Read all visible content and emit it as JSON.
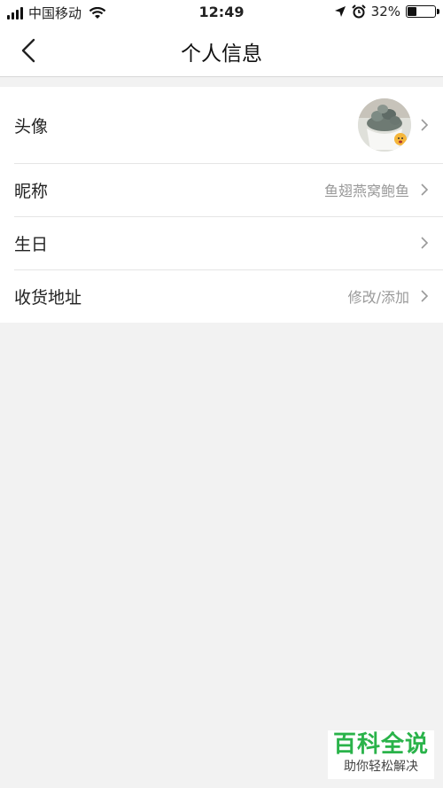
{
  "status_bar": {
    "carrier": "中国移动",
    "time": "12:49",
    "battery": "32%",
    "battery_level": 0.32
  },
  "nav": {
    "title": "个人信息",
    "back_icon": "chevron-left-icon"
  },
  "rows": [
    {
      "label": "头像",
      "value": ""
    },
    {
      "label": "昵称",
      "value": "鱼翅燕窝鲍鱼"
    },
    {
      "label": "生日",
      "value": ""
    },
    {
      "label": "收货地址",
      "value": "修改/添加"
    }
  ],
  "watermark": {
    "title": "百科全说",
    "subtitle": "助你轻松解决"
  },
  "colors": {
    "background": "#f2f2f2",
    "value_text": "#999999",
    "watermark_green": "#2ab34a"
  }
}
